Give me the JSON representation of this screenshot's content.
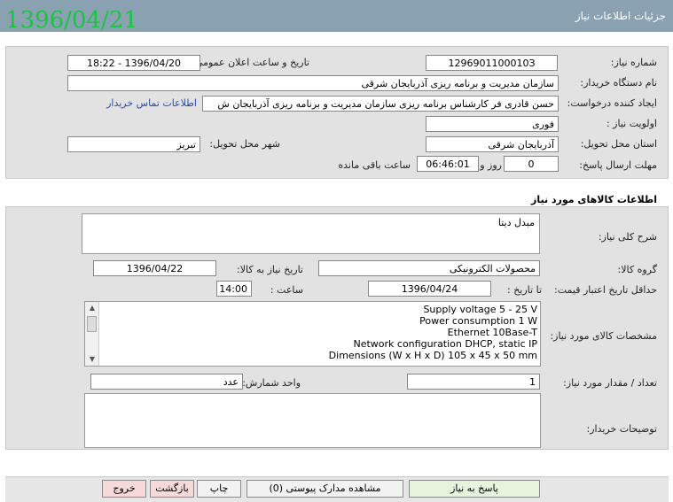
{
  "window": {
    "title": "جزئیات اطلاعات نیاز"
  },
  "stamp_date": "1396/04/21",
  "form": {
    "need_number_label": "شماره نیاز:",
    "need_number": "1296901100010З",
    "announce_label": "تاریخ و ساعت اعلان عمومی:",
    "announce_value": "1396/04/20 - 18:22",
    "buyer_label": "نام دستگاه خریدار:",
    "buyer_value": "سازمان مدیریت و برنامه ریزی  آذربایجان شرقی",
    "creator_label": "ایجاد کننده درخواست:",
    "creator_value": "حسن قادری فر کارشناس برنامه ریزی سازمان مدیریت و برنامه ریزی  آذربایجان ش",
    "contact_link": "اطلاعات تماس خریدار",
    "priority_label": "اولویت نیاز :",
    "priority_value": "فوری",
    "province_label": "استان محل تحویل:",
    "province_value": "آذربایجان شرقی",
    "city_label": "شهر محل تحویل:",
    "city_value": "تبریز",
    "deadline_label": "مهلت ارسال پاسخ:",
    "days_value": "0",
    "days_label": "روز و",
    "time_value": "06:46:01",
    "remaining_label": "ساعت باقی مانده"
  },
  "goods": {
    "section_title": "اطلاعات کالاهای مورد نیاز",
    "summary_label": "شرح کلی نیاز:",
    "summary_value": "مبدل دیتا",
    "group_label": "گروه کالا:",
    "group_value": "محصولات الکترونیکی",
    "need_date_label": "تاریخ نیاز به کالا:",
    "need_date_value": "1396/04/22",
    "validity_label": "حداقل تاریخ اعتبار قیمت:",
    "until_label": "تا تاریخ :",
    "validity_date": "1396/04/24",
    "time_label": "ساعت :",
    "time_value": "14:00",
    "specs_label": "مشخصات کالای مورد نیاز:",
    "specs": [
      "Supply voltage   5 - 25 V",
      "Power consumption   1 W",
      "Ethernet    10Base-T",
      "Network configuration   DHCP, static IP",
      "Dimensions (W x H x D)   105 x 45 x 50 mm"
    ],
    "qty_label": "تعداد / مقدار مورد نیاز:",
    "qty_value": "1",
    "unit_label": "واحد شمارش:",
    "unit_value": "عدد",
    "notes_label": "توضیحات خریدار:",
    "notes_value": ""
  },
  "buttons": {
    "reply": "پاسخ به نیاز",
    "docs": "مشاهده مدارک پیوستی (0)",
    "print": "چاپ",
    "back": "بازگشت",
    "exit": "خروج"
  }
}
